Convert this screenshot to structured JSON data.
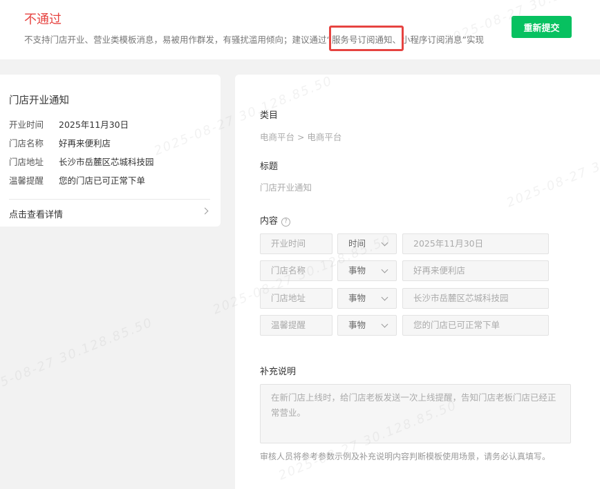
{
  "banner": {
    "status": "不通过",
    "reason_before": "不支持门店开业、营业类模板消息，易被用作群发，有骚扰滥用倾向；建议通过“",
    "reason_highlight": "服务号订阅通知、",
    "reason_after": "小程序订阅消息”实现",
    "resubmit_label": "重新提交",
    "highlight_color": "#e64340",
    "button_color": "#07c160"
  },
  "preview": {
    "title": "门店开业通知",
    "rows": [
      {
        "label": "开业时间",
        "value": "2025年11月30日"
      },
      {
        "label": "门店名称",
        "value": "好再来便利店"
      },
      {
        "label": "门店地址",
        "value": "长沙市岳麓区芯城科技园"
      },
      {
        "label": "温馨提醒",
        "value": "您的门店已可正常下单"
      }
    ],
    "detail_link": "点击查看详情"
  },
  "detail": {
    "category_label": "类目",
    "category_value": "电商平台 > 电商平台",
    "title_label": "标题",
    "title_value": "门店开业通知",
    "content_label": "内容",
    "content_help_icon": "question-circle-icon",
    "content_rows": [
      {
        "name": "开业时间",
        "type": "时间",
        "example": "2025年11月30日"
      },
      {
        "name": "门店名称",
        "type": "事物",
        "example": "好再来便利店"
      },
      {
        "name": "门店地址",
        "type": "事物",
        "example": "长沙市岳麓区芯城科技园"
      },
      {
        "name": "温馨提醒",
        "type": "事物",
        "example": "您的门店已可正常下单"
      }
    ],
    "note_label": "补充说明",
    "note_value": "在新门店上线时，给门店老板发送一次上线提醒，告知门店老板门店已经正常营业。",
    "hint": "审核人员将参考参数示例及补充说明内容判断模板使用场景，请务必认真填写。"
  },
  "watermark_text": "2025-08-27 30.128.85.50"
}
